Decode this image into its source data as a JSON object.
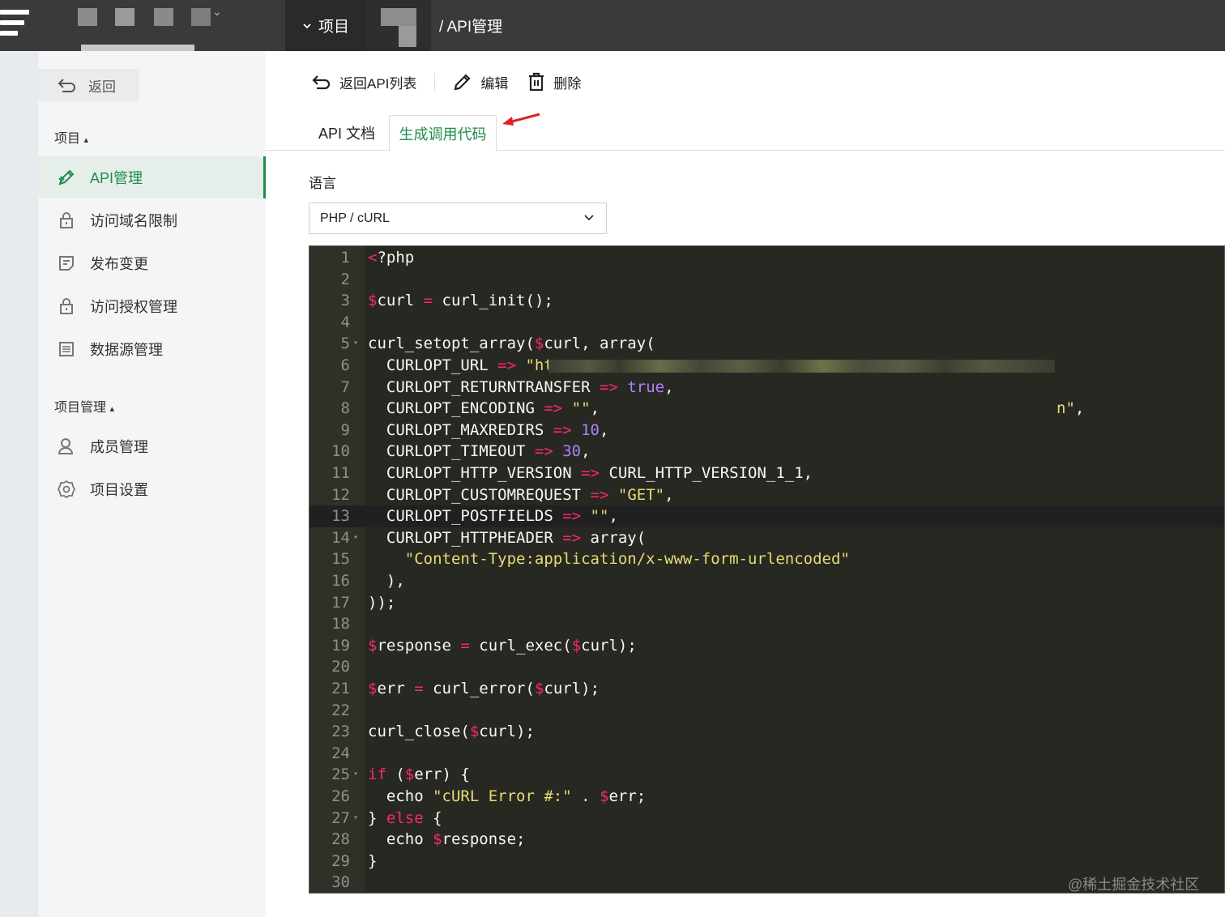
{
  "topbar": {
    "project_tab": "项目",
    "breadcrumb": "/ API管理"
  },
  "sidebar": {
    "back_label": "返回",
    "section1_title": "项目",
    "section1_items": [
      {
        "label": "API管理",
        "icon": "api-edit-icon",
        "active": true
      },
      {
        "label": "访问域名限制",
        "icon": "lock-icon"
      },
      {
        "label": "发布变更",
        "icon": "document-icon"
      },
      {
        "label": "访问授权管理",
        "icon": "lock-icon"
      },
      {
        "label": "数据源管理",
        "icon": "list-icon"
      }
    ],
    "section2_title": "项目管理",
    "section2_items": [
      {
        "label": "成员管理",
        "icon": "user-icon"
      },
      {
        "label": "项目设置",
        "icon": "gear-icon"
      }
    ]
  },
  "toolbar": {
    "back_to_list": "返回API列表",
    "edit": "编辑",
    "delete": "删除"
  },
  "tabs": {
    "doc": "API 文档",
    "gen_code": "生成调用代码"
  },
  "language": {
    "label": "语言",
    "selected": "PHP / cURL"
  },
  "code": {
    "line_numbers": [
      "1",
      "2",
      "3",
      "4",
      "5",
      "6",
      "7",
      "8",
      "9",
      "10",
      "11",
      "12",
      "13",
      "14",
      "15",
      "16",
      "17",
      "18",
      "19",
      "20",
      "21",
      "22",
      "23",
      "24",
      "25",
      "26",
      "27",
      "28",
      "29",
      "30"
    ],
    "highlighted_line": 13,
    "lines": {
      "l1_a": "<",
      "l1_b": "?php",
      "l3_a": "$",
      "l3_b": "curl ",
      "l3_c": "=",
      "l3_d": " curl_init();",
      "l5_a": "curl_setopt_array(",
      "l5_b": "$",
      "l5_c": "curl, array(",
      "l6_a": "  CURLOPT_URL ",
      "l6_b": "=>",
      "l6_c": " \"ht",
      "l6_d": "n\"",
      "l6_e": ",",
      "l7_a": "  CURLOPT_RETURNTRANSFER ",
      "l7_b": "=>",
      "l7_c": " true",
      "l7_d": ",",
      "l8_a": "  CURLOPT_ENCODING ",
      "l8_b": "=>",
      "l8_c": " \"\"",
      "l8_d": ",",
      "l9_a": "  CURLOPT_MAXREDIRS ",
      "l9_b": "=>",
      "l9_c": " 10",
      "l9_d": ",",
      "l10_a": "  CURLOPT_TIMEOUT ",
      "l10_b": "=>",
      "l10_c": " 30",
      "l10_d": ",",
      "l11_a": "  CURLOPT_HTTP_VERSION ",
      "l11_b": "=>",
      "l11_c": " CURL_HTTP_VERSION_1_1,",
      "l12_a": "  CURLOPT_CUSTOMREQUEST ",
      "l12_b": "=>",
      "l12_c": " \"GET\"",
      "l12_d": ",",
      "l13_a": "  CURLOPT_POSTFIELDS ",
      "l13_b": "=>",
      "l13_c": " \"\"",
      "l13_d": ",",
      "l14_a": "  CURLOPT_HTTPHEADER ",
      "l14_b": "=>",
      "l14_c": " array(",
      "l15_a": "    \"Content-Type:application/x-www-form-urlencoded\"",
      "l16_a": "  ),",
      "l17_a": "));",
      "l19_a": "$",
      "l19_b": "response ",
      "l19_c": "=",
      "l19_d": " curl_exec(",
      "l19_e": "$",
      "l19_f": "curl);",
      "l21_a": "$",
      "l21_b": "err ",
      "l21_c": "=",
      "l21_d": " curl_error(",
      "l21_e": "$",
      "l21_f": "curl);",
      "l23_a": "curl_close(",
      "l23_b": "$",
      "l23_c": "curl);",
      "l25_a": "if",
      "l25_b": " (",
      "l25_c": "$",
      "l25_d": "err) {",
      "l26_a": "  echo ",
      "l26_b": "\"cURL Error #:\"",
      "l26_c": " . ",
      "l26_d": "$",
      "l26_e": "err;",
      "l27_a": "} ",
      "l27_b": "else",
      "l27_c": " {",
      "l28_a": "  echo ",
      "l28_b": "$",
      "l28_c": "response;",
      "l29_a": "}"
    }
  },
  "watermark": "@稀土掘金技术社区",
  "colors": {
    "accent": "#1f8b4c",
    "topbar": "#3a3a3c",
    "editor_bg": "#272822",
    "keyword": "#f92672",
    "string": "#e6db74",
    "number": "#ae81ff"
  }
}
